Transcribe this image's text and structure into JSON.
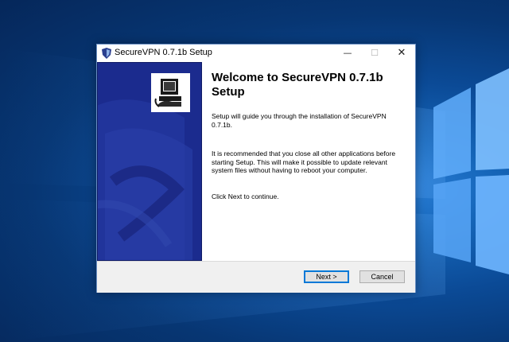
{
  "window": {
    "title": "SecureVPN 0.7.1b Setup",
    "controls": {
      "minimize": "—",
      "maximize": "☐",
      "close": "✕"
    }
  },
  "content": {
    "heading": "Welcome to SecureVPN 0.7.1b Setup",
    "paragraph1": "Setup will guide you through the installation of SecureVPN 0.7.1b.",
    "paragraph2": "It is recommended that you close all other applications before starting Setup. This will make it possible to update relevant system files without having to reboot your computer.",
    "paragraph3": "Click Next to continue."
  },
  "buttons": {
    "next_label": "Next >",
    "cancel_label": "Cancel"
  },
  "icons": {
    "app": "shield-icon",
    "installer": "installer-computer-icon"
  },
  "colors": {
    "desktop_blue": "#0b4a96",
    "side_panel_navy": "#1a2a8c",
    "button_accent": "#0078d7"
  }
}
